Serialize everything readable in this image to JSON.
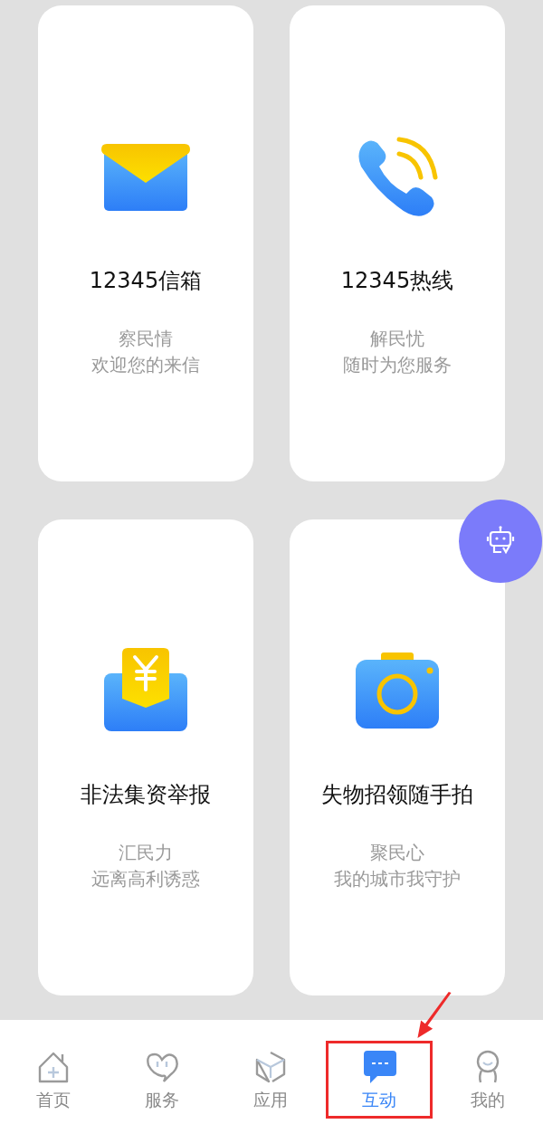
{
  "cards": [
    {
      "kind": "mail",
      "title": "12345信箱",
      "lines": [
        "察民情",
        "欢迎您的来信"
      ]
    },
    {
      "kind": "phone",
      "title": "12345热线",
      "lines": [
        "解民忧",
        "随时为您服务"
      ]
    },
    {
      "kind": "money",
      "title": "非法集资举报",
      "lines": [
        "汇民力",
        "远离高利诱惑"
      ]
    },
    {
      "kind": "camera",
      "title": "失物招领随手拍",
      "lines": [
        "聚民心",
        "我的城市我守护"
      ]
    }
  ],
  "tab_bar": [
    {
      "kind": "home",
      "label": "首页",
      "selected": false
    },
    {
      "kind": "heart",
      "label": "服务",
      "selected": false
    },
    {
      "kind": "box",
      "label": "应用",
      "selected": false
    },
    {
      "kind": "chat",
      "label": "互动",
      "selected": true,
      "highlighted": true
    },
    {
      "kind": "person",
      "label": "我的",
      "selected": false
    }
  ]
}
